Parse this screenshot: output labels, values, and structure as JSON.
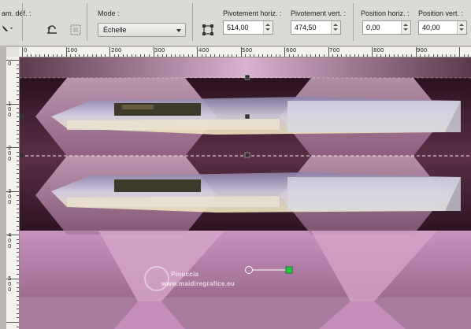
{
  "toolbar": {
    "param_label": "am. déf. :",
    "mode_label": "Mode :",
    "mode_value": "Échelle",
    "pivot_h_label": "Pivotement horiz. :",
    "pivot_h_value": "514,00",
    "pivot_v_label": "Pivotement vert. :",
    "pivot_v_value": "474,50",
    "pos_h_label": "Position horiz. :",
    "pos_h_value": "0,00",
    "pos_v_label": "Position vert. :",
    "pos_v_value": "40,00"
  },
  "ruler_top": [
    "0",
    "100",
    "200",
    "300",
    "400",
    "500",
    "600",
    "700",
    "800",
    "900"
  ],
  "ruler_left": [
    "0",
    "1 0 0",
    "2 0 0",
    "3 0 0",
    "4 0 0",
    "5 0 0"
  ],
  "watermark": {
    "brand": "Pinuccia",
    "url": "www.maidiregrafice.eu"
  },
  "colors": {
    "canvas_dark": "#3a1c2c",
    "canvas_pink": "#c89ab8",
    "handle_green": "#22cc44"
  }
}
